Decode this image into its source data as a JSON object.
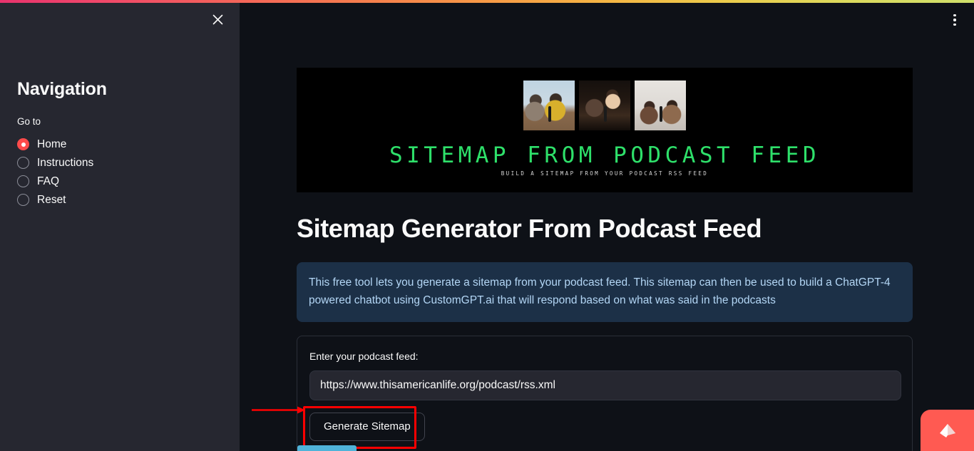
{
  "window": {
    "kebab_menu_icon": "more-vertical-icon",
    "close_icon": "close-icon"
  },
  "sidebar": {
    "title": "Navigation",
    "radio_group_label": "Go to",
    "items": [
      {
        "label": "Home",
        "selected": true
      },
      {
        "label": "Instructions",
        "selected": false
      },
      {
        "label": "FAQ",
        "selected": false
      },
      {
        "label": "Reset",
        "selected": false
      }
    ]
  },
  "banner": {
    "title": "SITEMAP FROM PODCAST FEED",
    "subtitle": "BUILD A SITEMAP FROM YOUR PODCAST RSS FEED",
    "photo_count": 3,
    "title_color": "#2ee06a",
    "background_color": "#000000"
  },
  "main": {
    "page_title": "Sitemap Generator From Podcast Feed",
    "info_box": {
      "text": "This free tool lets you generate a sitemap from your podcast feed. This sitemap can then be used to build a ChatGPT-4 powered chatbot using CustomGPT.ai that will respond based on what was said in the podcasts",
      "background_color": "#1c3047",
      "text_color": "#b3d6f5"
    },
    "form": {
      "field_label": "Enter your podcast feed:",
      "input_value": "https://www.thisamericanlife.org/podcast/rss.xml",
      "input_placeholder": "",
      "submit_label": "Generate Sitemap"
    }
  },
  "annotations": {
    "highlight_color": "#ff0000",
    "arrow_icon": "arrow-right-icon"
  },
  "floating_widget": {
    "icon": "origami-crown-icon",
    "color": "#ff5a52"
  }
}
